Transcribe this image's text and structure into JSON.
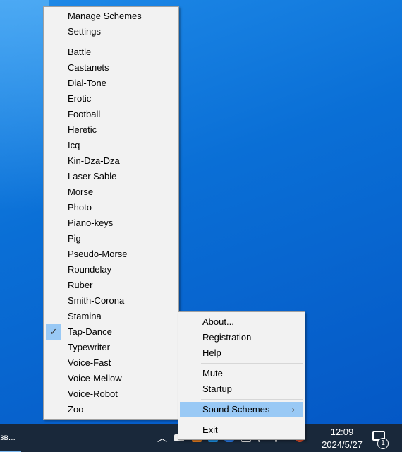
{
  "main_menu": {
    "top_items": [
      "Manage Schemes",
      "Settings"
    ],
    "schemes": [
      "Battle",
      "Castanets",
      "Dial-Tone",
      "Erotic",
      "Football",
      "Heretic",
      "Icq",
      "Kin-Dza-Dza",
      "Laser Sable",
      "Morse",
      "Photo",
      "Piano-keys",
      "Pig",
      "Pseudo-Morse",
      "Roundelay",
      "Ruber",
      "Smith-Corona",
      "Stamina",
      "Tap-Dance",
      "Typewriter",
      "Voice-Fast",
      "Voice-Mellow",
      "Voice-Robot",
      "Zoo"
    ],
    "checked": "Tap-Dance"
  },
  "tray_menu": {
    "group1": [
      "About...",
      "Registration",
      "Help"
    ],
    "group2": [
      "Mute",
      "Startup"
    ],
    "sound_schemes": "Sound Schemes",
    "exit": "Exit"
  },
  "taskbar": {
    "app_label": "зв...",
    "time": "12:09",
    "date": "2024/5/27",
    "notification_count": "1"
  },
  "colors": {
    "highlight": "#99c9f5",
    "taskbar": "#19283a",
    "menu_bg": "#f2f2f2"
  }
}
